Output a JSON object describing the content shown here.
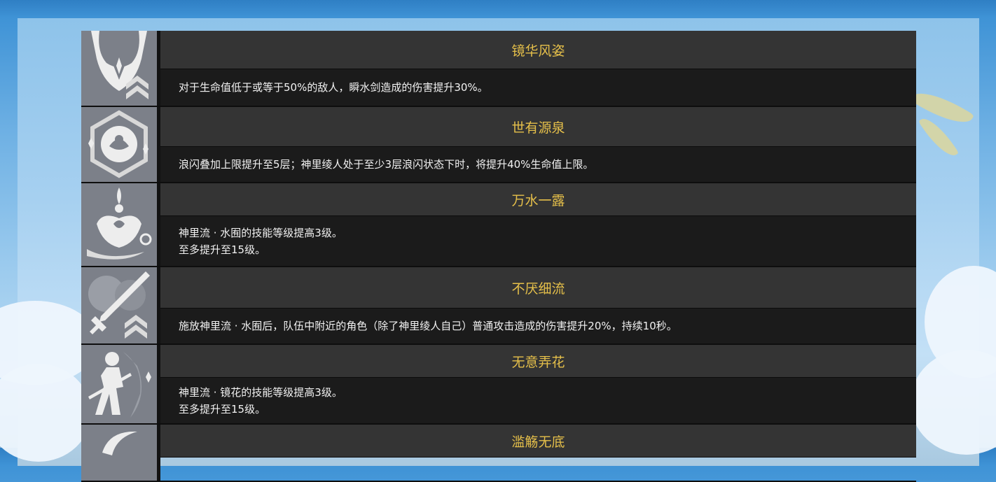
{
  "talents": [
    {
      "icon": "horned-helm-icon",
      "title": "镜华风姿",
      "lines": [
        "对于生命值低于或等于50%的敌人，瞬水剑造成的伤害提升30%。"
      ]
    },
    {
      "icon": "flower-hexagon-icon",
      "title": "世有源泉",
      "lines": [
        "浪闪叠加上限提升至5层；神里绫人处于至少3层浪闪状态下时，将提升40%生命值上限。"
      ]
    },
    {
      "icon": "water-lotus-icon",
      "title": "万水一露",
      "lines": [
        "神里流 · 水囿的技能等级提高3级。",
        "至多提升至15级。"
      ]
    },
    {
      "icon": "sword-chevron-icon",
      "title": "不厌细流",
      "lines": [
        "施放神里流 · 水囿后，队伍中附近的角色（除了神里绫人自己）普通攻击造成的伤害提升20%，持续10秒。"
      ]
    },
    {
      "icon": "swordsman-icon",
      "title": "无意弄花",
      "lines": [
        "神里流 · 镜花的技能等级提高3级。",
        "至多提升至15级。"
      ]
    },
    {
      "icon": "wave-crescent-icon",
      "title": "滥觞无底",
      "lines": []
    }
  ]
}
